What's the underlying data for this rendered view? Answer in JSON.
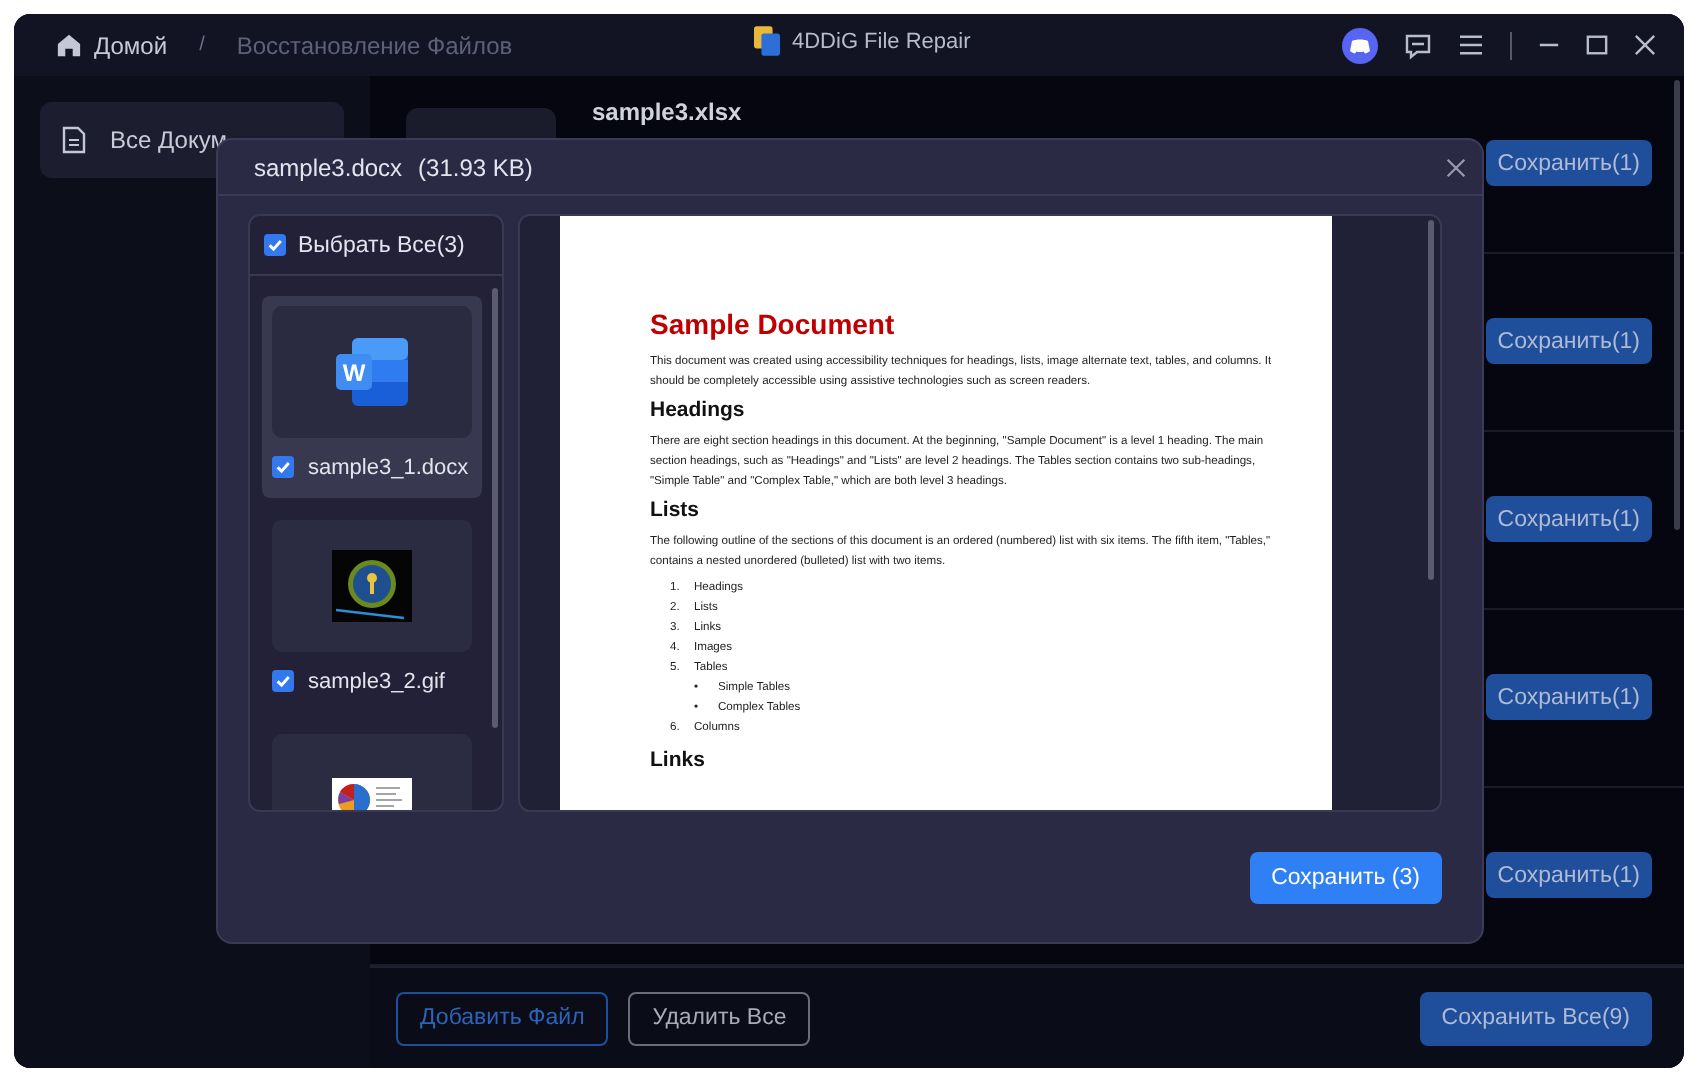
{
  "title_bar": {
    "breadcrumb": [
      "Домой",
      "Восстановление Файлов"
    ],
    "separator": "/",
    "app_name": "4DDiG File Repair"
  },
  "sidebar": {
    "items": [
      {
        "label": "Все Докум",
        "selected": true
      }
    ]
  },
  "rows": [
    {
      "name": "sample3.xlsx",
      "button": "Сохранить(1)"
    },
    {
      "button": "Сохранить(1)"
    },
    {
      "button": "Сохранить(1)"
    },
    {
      "button": "Сохранить(1)"
    },
    {
      "button": "Сохранить(1)"
    }
  ],
  "bottom_bar": {
    "add_button": "Добавить Файл",
    "delete_button": "Удалить Все",
    "save_all_button": "Сохранить Все(9)"
  },
  "dialog": {
    "file_name": "sample3.docx",
    "file_size": "(31.93 KB)",
    "select_all": {
      "label": "Выбрать Все(3)",
      "checked": true
    },
    "files": [
      {
        "name": "sample3_1.docx",
        "kind": "word",
        "icon_letter": "W",
        "checked": true,
        "selected": true
      },
      {
        "name": "sample3_2.gif",
        "kind": "gif",
        "checked": true,
        "selected": false
      },
      {
        "kind": "chart",
        "selected": false
      }
    ],
    "preview": {
      "title": "Sample Document",
      "blocks": [
        {
          "kind": "paragraph",
          "text": "This document was created using accessibility techniques for headings, lists, image alternate text, tables, and columns. It should be completely accessible using assistive technologies such as screen readers."
        },
        {
          "kind": "heading",
          "text": "Headings"
        },
        {
          "kind": "paragraph",
          "text": "There are eight section headings in this document. At the beginning, \"Sample Document\" is a level 1 heading. The main section headings, such as \"Headings\" and \"Lists\" are level 2 headings. The Tables section contains two sub-headings, \"Simple Table\" and \"Complex Table,\" which are both level 3 headings."
        },
        {
          "kind": "heading",
          "text": "Lists"
        },
        {
          "kind": "paragraph",
          "text": "The following outline of the sections of this document is an ordered (numbered) list with six items. The fifth item, \"Tables,\" contains a nested unordered (bulleted) list with two items."
        },
        {
          "kind": "list",
          "items": [
            {
              "marker": "1.",
              "text": "Headings"
            },
            {
              "marker": "2.",
              "text": "Lists"
            },
            {
              "marker": "3.",
              "text": "Links"
            },
            {
              "marker": "4.",
              "text": "Images"
            },
            {
              "marker": "5.",
              "text": "Tables",
              "children": [
                {
                  "marker": "•",
                  "text": "Simple Tables"
                },
                {
                  "marker": "•",
                  "text": "Complex Tables"
                }
              ]
            },
            {
              "marker": "6.",
              "text": "Columns"
            }
          ]
        },
        {
          "kind": "heading",
          "text": "Links"
        }
      ]
    },
    "save_button": "Сохранить (3)"
  }
}
